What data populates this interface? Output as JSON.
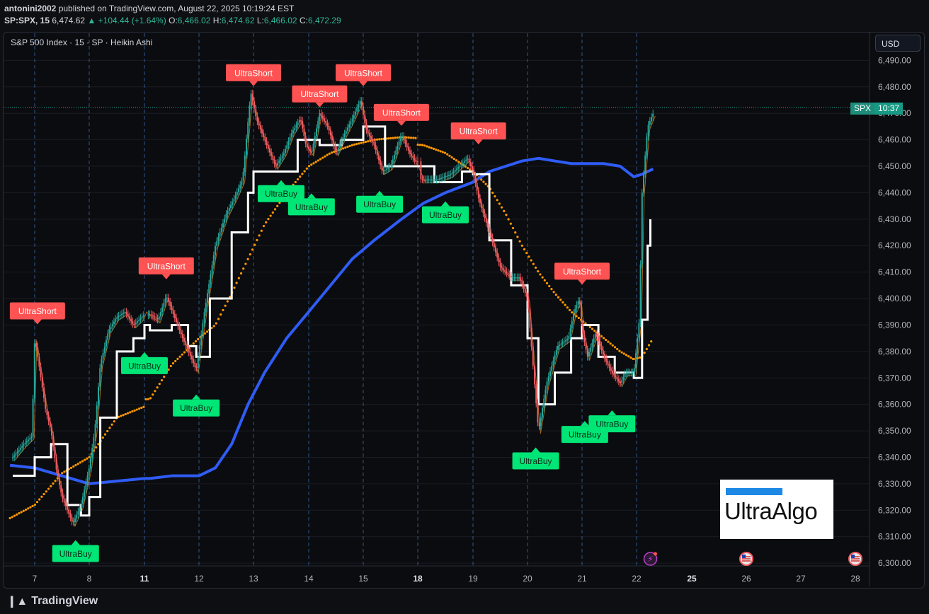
{
  "header": {
    "author": "antonini2002",
    "published_text": "published on TradingView.com, August 22, 2025 10:19:24 EST",
    "symbol": "SP:SPX, 15",
    "last": "6,474.62",
    "change": "▲ +104.44 (+1.64%)",
    "open_label": "O:",
    "open": "6,466.02",
    "high_label": "H:",
    "high": "6,474.62",
    "low_label": "L:",
    "low": "6,466.02",
    "close_label": "C:",
    "close": "6,472.29"
  },
  "legend_text": "S&P 500 Index · 15 · SP · Heikin Ashi",
  "currency_button": "USD",
  "price_tag": {
    "symbol": "SPX",
    "countdown": "10:37"
  },
  "logo": {
    "text": "UltraAlgo"
  },
  "footer": {
    "brand": "TradingView"
  },
  "colors": {
    "up": "#26a69a",
    "down": "#f05a60",
    "ma_white": "#ffffff",
    "ma_orange": "#ff9800",
    "ma_blue": "#2f5cf5",
    "buy_label": "#00e676",
    "short_label": "#ff5252"
  },
  "chart_data": {
    "type": "line",
    "title": "S&P 500 Index · 15 · SP · Heikin Ashi",
    "y_ticks": [
      6300,
      6310,
      6320,
      6330,
      6340,
      6350,
      6360,
      6370,
      6380,
      6390,
      6400,
      6410,
      6420,
      6430,
      6440,
      6450,
      6460,
      6470,
      6480,
      6490
    ],
    "y_tick_labels": [
      "6,300.00",
      "6,310.00",
      "6,320.00",
      "6,330.00",
      "6,340.00",
      "6,350.00",
      "6,360.00",
      "6,370.00",
      "6,380.00",
      "6,390.00",
      "6,400.00",
      "6,410.00",
      "6,420.00",
      "6,430.00",
      "6,440.00",
      "6,450.00",
      "6,460.00",
      "6,470.00",
      "6,480.00",
      "6,490.00"
    ],
    "ylim": [
      6296,
      6495
    ],
    "x_ticks": [
      {
        "label": "7",
        "day": 7,
        "bold": false
      },
      {
        "label": "8",
        "day": 8,
        "bold": false
      },
      {
        "label": "11",
        "day": 11,
        "bold": true
      },
      {
        "label": "12",
        "day": 12,
        "bold": false
      },
      {
        "label": "13",
        "day": 13,
        "bold": false
      },
      {
        "label": "14",
        "day": 14,
        "bold": false
      },
      {
        "label": "15",
        "day": 15,
        "bold": false
      },
      {
        "label": "18",
        "day": 18,
        "bold": true
      },
      {
        "label": "19",
        "day": 19,
        "bold": false
      },
      {
        "label": "20",
        "day": 20,
        "bold": false
      },
      {
        "label": "21",
        "day": 21,
        "bold": false
      },
      {
        "label": "22",
        "day": 22,
        "bold": false
      },
      {
        "label": "25",
        "day": 25,
        "bold": true
      },
      {
        "label": "26",
        "day": 26,
        "bold": false
      },
      {
        "label": "27",
        "day": 27,
        "bold": false
      },
      {
        "label": "28",
        "day": 28,
        "bold": false
      }
    ],
    "session_days": [
      7,
      8,
      11,
      12,
      13,
      14,
      15,
      18,
      19,
      20,
      21,
      22
    ],
    "series": [
      {
        "name": "price",
        "points": [
          [
            6.6,
            6340
          ],
          [
            6.8,
            6345
          ],
          [
            6.95,
            6348
          ],
          [
            7.0,
            6385
          ],
          [
            7.1,
            6372
          ],
          [
            7.2,
            6358
          ],
          [
            7.3,
            6350
          ],
          [
            7.4,
            6335
          ],
          [
            7.5,
            6325
          ],
          [
            7.7,
            6315
          ],
          [
            7.85,
            6322
          ],
          [
            8.0,
            6336
          ],
          [
            8.1,
            6350
          ],
          [
            8.2,
            6375
          ],
          [
            8.35,
            6388
          ],
          [
            8.5,
            6393
          ],
          [
            8.65,
            6395
          ],
          [
            8.8,
            6390
          ],
          [
            8.95,
            6393
          ],
          [
            9.1,
            6396
          ],
          [
            11.1,
            6394
          ],
          [
            11.25,
            6392
          ],
          [
            11.4,
            6401
          ],
          [
            11.55,
            6393
          ],
          [
            11.7,
            6385
          ],
          [
            11.85,
            6378
          ],
          [
            11.95,
            6373
          ],
          [
            12.1,
            6395
          ],
          [
            12.3,
            6420
          ],
          [
            12.5,
            6432
          ],
          [
            12.65,
            6438
          ],
          [
            12.8,
            6445
          ],
          [
            12.95,
            6478
          ],
          [
            13.05,
            6468
          ],
          [
            13.2,
            6460
          ],
          [
            13.4,
            6450
          ],
          [
            13.55,
            6455
          ],
          [
            13.7,
            6463
          ],
          [
            13.85,
            6468
          ],
          [
            13.95,
            6458
          ],
          [
            14.05,
            6455
          ],
          [
            14.2,
            6470
          ],
          [
            14.35,
            6465
          ],
          [
            14.5,
            6455
          ],
          [
            14.65,
            6462
          ],
          [
            14.8,
            6468
          ],
          [
            14.95,
            6475
          ],
          [
            15.05,
            6464
          ],
          [
            15.2,
            6458
          ],
          [
            15.35,
            6448
          ],
          [
            15.5,
            6450
          ],
          [
            15.7,
            6462
          ],
          [
            15.85,
            6455
          ],
          [
            15.95,
            6452
          ],
          [
            18.1,
            6445
          ],
          [
            18.35,
            6445
          ],
          [
            18.6,
            6447
          ],
          [
            18.9,
            6453
          ],
          [
            19.0,
            6448
          ],
          [
            19.1,
            6438
          ],
          [
            19.3,
            6425
          ],
          [
            19.5,
            6412
          ],
          [
            19.7,
            6408
          ],
          [
            19.85,
            6408
          ],
          [
            20.0,
            6400
          ],
          [
            20.1,
            6375
          ],
          [
            20.2,
            6350
          ],
          [
            20.35,
            6368
          ],
          [
            20.55,
            6382
          ],
          [
            20.75,
            6385
          ],
          [
            20.85,
            6395
          ],
          [
            20.95,
            6400
          ],
          [
            21.0,
            6388
          ],
          [
            21.1,
            6378
          ],
          [
            21.25,
            6387
          ],
          [
            21.4,
            6378
          ],
          [
            21.55,
            6372
          ],
          [
            21.7,
            6368
          ],
          [
            21.8,
            6372
          ],
          [
            21.95,
            6372
          ],
          [
            22.05,
            6392
          ],
          [
            22.1,
            6440
          ],
          [
            22.2,
            6465
          ],
          [
            22.3,
            6470
          ]
        ]
      },
      {
        "name": "white",
        "points": [
          [
            6.6,
            6333
          ],
          [
            7.0,
            6340
          ],
          [
            7.3,
            6345
          ],
          [
            7.6,
            6322
          ],
          [
            7.85,
            6318
          ],
          [
            8.0,
            6325
          ],
          [
            8.2,
            6355
          ],
          [
            8.5,
            6380
          ],
          [
            8.8,
            6385
          ],
          [
            9.1,
            6390
          ],
          [
            11.1,
            6388
          ],
          [
            11.5,
            6390
          ],
          [
            11.8,
            6382
          ],
          [
            11.95,
            6378
          ],
          [
            12.2,
            6400
          ],
          [
            12.6,
            6425
          ],
          [
            12.9,
            6440
          ],
          [
            13.0,
            6448
          ],
          [
            13.4,
            6448
          ],
          [
            13.8,
            6460
          ],
          [
            14.2,
            6458
          ],
          [
            14.6,
            6460
          ],
          [
            15.0,
            6465
          ],
          [
            15.4,
            6450
          ],
          [
            15.95,
            6450
          ],
          [
            18.3,
            6444
          ],
          [
            18.8,
            6448
          ],
          [
            19.0,
            6447
          ],
          [
            19.3,
            6422
          ],
          [
            19.7,
            6405
          ],
          [
            20.0,
            6385
          ],
          [
            20.2,
            6360
          ],
          [
            20.5,
            6372
          ],
          [
            20.8,
            6385
          ],
          [
            21.0,
            6390
          ],
          [
            21.3,
            6378
          ],
          [
            21.6,
            6372
          ],
          [
            21.95,
            6370
          ],
          [
            22.1,
            6392
          ],
          [
            22.2,
            6420
          ],
          [
            22.25,
            6430
          ]
        ]
      },
      {
        "name": "orange",
        "points": [
          [
            6.55,
            6317
          ],
          [
            7.0,
            6322
          ],
          [
            7.5,
            6334
          ],
          [
            8.0,
            6340
          ],
          [
            8.5,
            6355
          ],
          [
            9.1,
            6360
          ],
          [
            11.1,
            6362
          ],
          [
            11.5,
            6375
          ],
          [
            12.0,
            6385
          ],
          [
            12.3,
            6390
          ],
          [
            12.6,
            6402
          ],
          [
            12.9,
            6415
          ],
          [
            13.2,
            6428
          ],
          [
            13.6,
            6440
          ],
          [
            14.0,
            6450
          ],
          [
            14.4,
            6455
          ],
          [
            14.8,
            6458
          ],
          [
            15.2,
            6460
          ],
          [
            15.7,
            6461
          ],
          [
            18.1,
            6458
          ],
          [
            18.5,
            6455
          ],
          [
            19.0,
            6448
          ],
          [
            19.3,
            6442
          ],
          [
            19.6,
            6432
          ],
          [
            19.9,
            6420
          ],
          [
            20.2,
            6410
          ],
          [
            20.5,
            6402
          ],
          [
            20.8,
            6395
          ],
          [
            21.1,
            6390
          ],
          [
            21.4,
            6385
          ],
          [
            21.7,
            6380
          ],
          [
            21.95,
            6377
          ],
          [
            22.1,
            6378
          ],
          [
            22.3,
            6385
          ]
        ]
      },
      {
        "name": "blue",
        "points": [
          [
            6.55,
            6337
          ],
          [
            7.0,
            6336
          ],
          [
            7.5,
            6333
          ],
          [
            8.0,
            6330
          ],
          [
            8.5,
            6331
          ],
          [
            9.1,
            6332
          ],
          [
            11.1,
            6332
          ],
          [
            11.5,
            6333
          ],
          [
            12.0,
            6333
          ],
          [
            12.3,
            6336
          ],
          [
            12.6,
            6345
          ],
          [
            12.9,
            6360
          ],
          [
            13.2,
            6372
          ],
          [
            13.6,
            6385
          ],
          [
            14.0,
            6395
          ],
          [
            14.4,
            6405
          ],
          [
            14.8,
            6415
          ],
          [
            15.2,
            6422
          ],
          [
            15.7,
            6430
          ],
          [
            18.1,
            6436
          ],
          [
            18.5,
            6440
          ],
          [
            19.0,
            6444
          ],
          [
            19.3,
            6448
          ],
          [
            19.6,
            6450
          ],
          [
            19.9,
            6452
          ],
          [
            20.2,
            6453
          ],
          [
            20.5,
            6452
          ],
          [
            20.8,
            6451
          ],
          [
            21.1,
            6451
          ],
          [
            21.4,
            6451
          ],
          [
            21.7,
            6450
          ],
          [
            21.95,
            6446
          ],
          [
            22.1,
            6447
          ],
          [
            22.3,
            6449
          ]
        ]
      }
    ],
    "signals": [
      {
        "label": "UltraShort",
        "type": "short",
        "day": 7.05,
        "price": 6390
      },
      {
        "label": "UltraBuy",
        "type": "buy",
        "day": 7.75,
        "price": 6309
      },
      {
        "label": "UltraBuy",
        "type": "buy",
        "day": 10.95,
        "price": 6380
      },
      {
        "label": "UltraShort",
        "type": "short",
        "day": 11.4,
        "price": 6407
      },
      {
        "label": "UltraBuy",
        "type": "buy",
        "day": 11.95,
        "price": 6364
      },
      {
        "label": "UltraShort",
        "type": "short",
        "day": 13.0,
        "price": 6480
      },
      {
        "label": "UltraBuy",
        "type": "buy",
        "day": 13.5,
        "price": 6445
      },
      {
        "label": "UltraBuy",
        "type": "buy",
        "day": 14.05,
        "price": 6440
      },
      {
        "label": "UltraShort",
        "type": "short",
        "day": 14.2,
        "price": 6472
      },
      {
        "label": "UltraShort",
        "type": "short",
        "day": 15.0,
        "price": 6480
      },
      {
        "label": "UltraBuy",
        "type": "buy",
        "day": 15.3,
        "price": 6441
      },
      {
        "label": "UltraShort",
        "type": "short",
        "day": 15.7,
        "price": 6465
      },
      {
        "label": "UltraBuy",
        "type": "buy",
        "day": 18.5,
        "price": 6437
      },
      {
        "label": "UltraShort",
        "type": "short",
        "day": 19.1,
        "price": 6458
      },
      {
        "label": "UltraBuy",
        "type": "buy",
        "day": 20.15,
        "price": 6344
      },
      {
        "label": "UltraShort",
        "type": "short",
        "day": 21.0,
        "price": 6405
      },
      {
        "label": "UltraBuy",
        "type": "buy",
        "day": 21.05,
        "price": 6354
      },
      {
        "label": "UltraBuy",
        "type": "buy",
        "day": 21.55,
        "price": 6358
      }
    ],
    "event_icons": [
      {
        "name": "lightning-icon",
        "day": 22.25
      },
      {
        "name": "us-flag-icon",
        "day": 26.0
      },
      {
        "name": "us-flag-icon",
        "day": 28.0
      }
    ],
    "last_price_line": 6472.29
  }
}
